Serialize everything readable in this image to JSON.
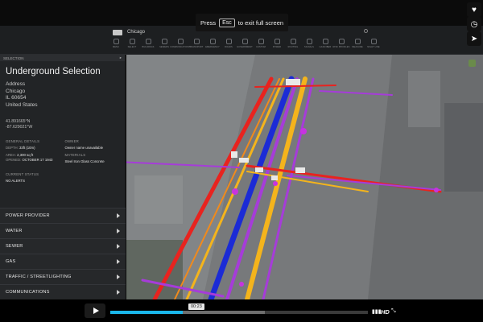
{
  "fullscreen_notice": {
    "prefix": "Press",
    "key": "Esc",
    "suffix": "to exit full screen"
  },
  "header": {
    "city": "Chicago",
    "layers": [
      "MENU",
      "SELECT",
      "BUILDINGS",
      "SEWERS",
      "COMMUNICATIONS",
      "TRANSPORT",
      "EMERGENCY",
      "ROADS",
      "GOVERNMENT",
      "CUSTOM",
      "POWER",
      "ROUTING",
      "SIGNALS",
      "GAS/FIBER",
      "RISK PROFILES",
      "MEASURE",
      "NIGHT LINE"
    ]
  },
  "panel": {
    "header_label": "SELECTION",
    "title": "Underground Selection",
    "address": [
      "Address",
      "Chicago",
      "IL 60654",
      "United States"
    ],
    "coords": [
      "41.891665°N",
      "-87.629021°W"
    ],
    "general_details_heading": "GENERAL DETAILS",
    "depth_label": "DEPTH:",
    "depth_value": "33ft (10m)",
    "area_label": "AREA:",
    "area_value": "2,300 sq ft",
    "opened_label": "OPENED:",
    "opened_value": "OCTOBER 17 1943",
    "owner_heading": "OWNER",
    "owner_value": "Owner name unavailable",
    "materials_heading": "MATERIALS",
    "materials_value": "Steel Iron Glass Concrete",
    "status_heading": "CURRENT STATUS",
    "status_value": "NO ALERTS",
    "utilities": [
      "POWER PROVIDER",
      "WATER",
      "SEWER",
      "GAS",
      "TRAFFIC / STREETLIGHTING",
      "COMMUNICATIONS"
    ]
  },
  "player": {
    "time": "00:23",
    "progress": 0.28,
    "buffered": 0.6,
    "hd_label": "HD"
  },
  "colors": {
    "accent": "#1ab7ea",
    "pipe_red": "#e8231f",
    "pipe_blue": "#1b2bd6",
    "pipe_yellow": "#f4b41c",
    "pipe_purple": "#a63cd9"
  }
}
